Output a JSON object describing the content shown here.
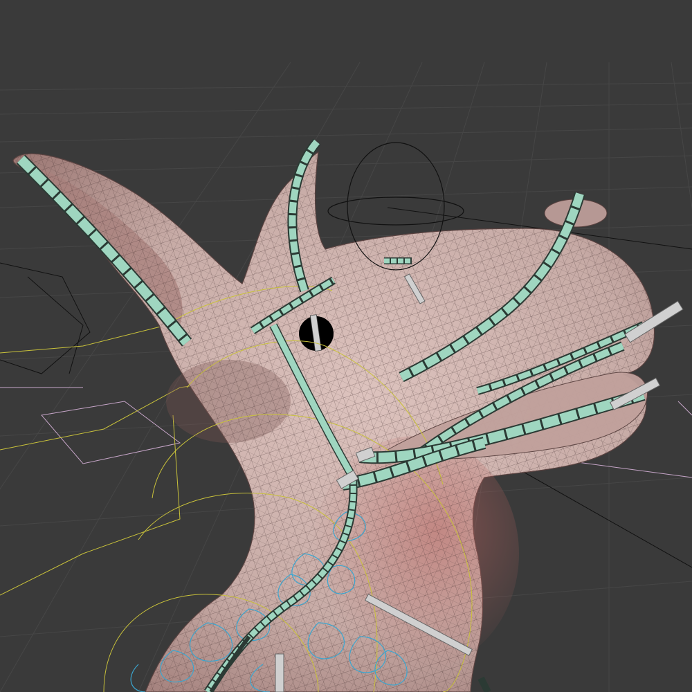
{
  "viewport": {
    "view": "3d-viewport",
    "background_color": "#3a3a3a",
    "grid_color": "#484848",
    "model": {
      "name": "character-head",
      "skin_color": "#c7aba6",
      "shadow_color": "#7a5654",
      "wire_color": "#3d2c2a"
    },
    "rig_colors": {
      "deform_bones": "#9fd6c0",
      "bone_outline": "#2b3a34",
      "control_bones": "#d0d0d0",
      "yellow_controls": "#c9c23a",
      "cyan_controls": "#3aa6d0",
      "pink_controls": "#c7a6c9",
      "black_controls": "#111111",
      "eye": "#000000"
    }
  }
}
